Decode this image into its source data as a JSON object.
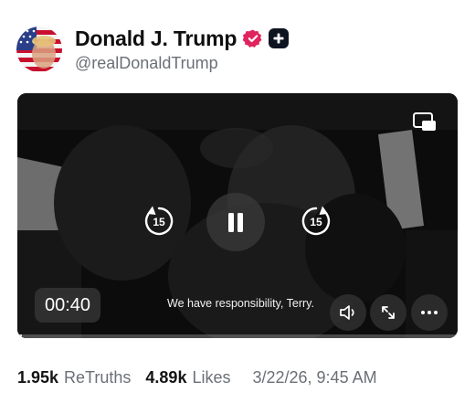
{
  "post": {
    "author": {
      "display_name": "Donald J. Trump",
      "handle": "@realDonaldTrump",
      "verified_icon": "verified-badge-icon",
      "badge_icon": "plus-badge-icon",
      "verified_color": "#e0245e"
    },
    "video": {
      "elapsed_time": "00:40",
      "caption": "We have responsibility, Terry.",
      "skip_back_seconds": "15",
      "skip_forward_seconds": "15",
      "progress": 0.01,
      "state_icon": "pause-icon"
    },
    "stats": {
      "retruths_count": "1.95k",
      "retruths_label": "ReTruths",
      "likes_count": "4.89k",
      "likes_label": "Likes",
      "timestamp": "3/22/26, 9:45 AM"
    }
  }
}
